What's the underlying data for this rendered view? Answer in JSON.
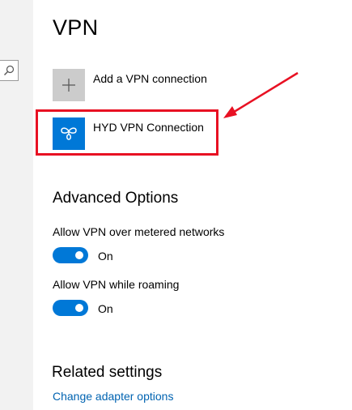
{
  "page_title": "VPN",
  "search": {
    "icon": "search-icon"
  },
  "vpn_list": {
    "add_label": "Add a VPN connection",
    "connections": [
      {
        "label": "HYD VPN Connection",
        "icon": "vpn-connection-icon"
      }
    ]
  },
  "advanced": {
    "title": "Advanced Options",
    "settings": [
      {
        "label": "Allow VPN over metered networks",
        "state": "On"
      },
      {
        "label": "Allow VPN while roaming",
        "state": "On"
      }
    ]
  },
  "related": {
    "title": "Related settings",
    "link": "Change adapter options"
  },
  "colors": {
    "accent": "#0078d7",
    "annotation": "#e81123",
    "link": "#0063b1"
  }
}
